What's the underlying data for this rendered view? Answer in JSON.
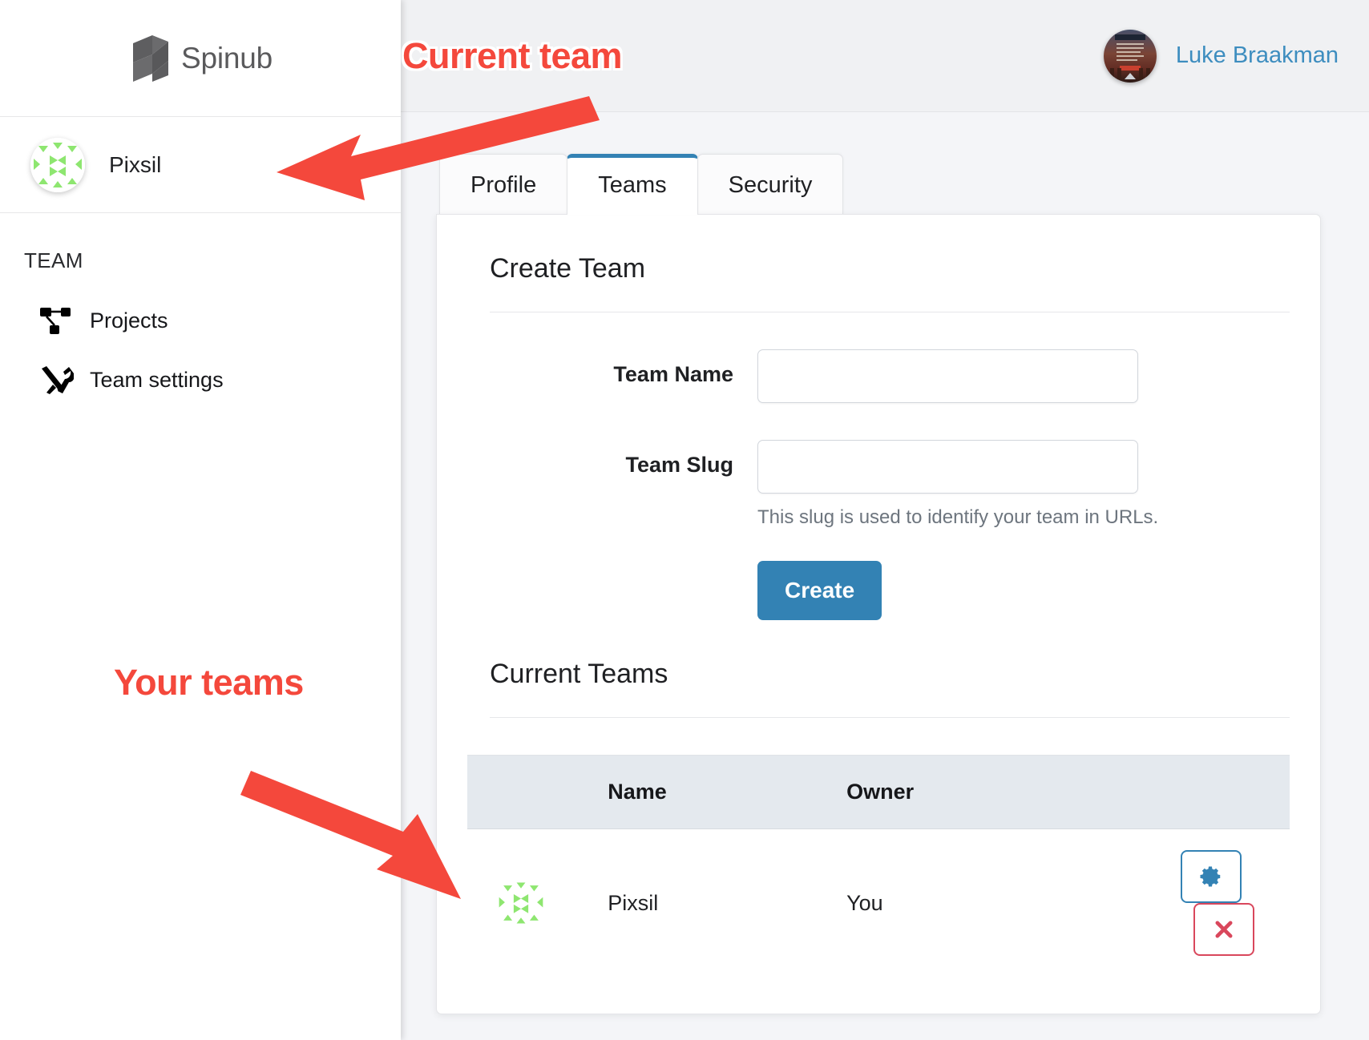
{
  "brand": {
    "name": "Spinub",
    "logo_icon": "spinub-logo-icon"
  },
  "sidebar": {
    "current_team": {
      "name": "Pixsil",
      "avatar_icon": "pixsil-team-avatar"
    },
    "section_heading": "TEAM",
    "items": [
      {
        "label": "Projects",
        "icon": "sitemap-icon"
      },
      {
        "label": "Team settings",
        "icon": "tools-icon"
      }
    ]
  },
  "topbar": {
    "user": {
      "name": "Luke Braakman",
      "avatar_icon": "user-avatar-image"
    }
  },
  "tabs": [
    {
      "label": "Profile",
      "active": false
    },
    {
      "label": "Teams",
      "active": true
    },
    {
      "label": "Security",
      "active": false
    }
  ],
  "create_team": {
    "title": "Create Team",
    "fields": [
      {
        "label": "Team Name",
        "value": "",
        "placeholder": ""
      },
      {
        "label": "Team Slug",
        "value": "",
        "placeholder": ""
      }
    ],
    "slug_help": "This slug is used to identify your team in URLs.",
    "submit_label": "Create"
  },
  "current_teams": {
    "title": "Current Teams",
    "columns": [
      "",
      "Name",
      "Owner",
      ""
    ],
    "rows": [
      {
        "avatar_icon": "pixsil-team-avatar",
        "name": "Pixsil",
        "owner": "You",
        "settings_icon": "gear-icon",
        "remove_icon": "close-x-icon"
      }
    ]
  },
  "annotations": [
    {
      "text": "Current team"
    },
    {
      "text": "Your teams"
    }
  ],
  "colors": {
    "accent_blue": "#3382b4",
    "link_blue": "#3d8dbf",
    "danger_red": "#d9475c",
    "annotation_red": "#f4483c",
    "table_header_bg": "#e4e9ee",
    "page_bg": "#f4f5f8"
  }
}
